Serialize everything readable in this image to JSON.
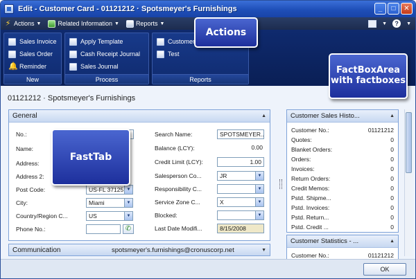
{
  "window": {
    "title": "Edit - Customer Card - 01121212 · Spotsmeyer's Furnishings"
  },
  "menubar": {
    "items": [
      {
        "label": "Actions",
        "icon": "lightning-icon"
      },
      {
        "label": "Related Information",
        "icon": "related-info-icon"
      },
      {
        "label": "Reports",
        "icon": "reports-icon"
      }
    ],
    "help_label": "?"
  },
  "ribbon": {
    "groups": [
      {
        "label": "New",
        "items": [
          "Sales Invoice",
          "Sales Order",
          "Reminder"
        ]
      },
      {
        "label": "Process",
        "items": [
          "Apply Template",
          "Cash Receipt Journal",
          "Sales Journal"
        ]
      },
      {
        "label": "Reports",
        "items": [
          "Customer",
          "Test"
        ]
      }
    ]
  },
  "page": {
    "title": "01121212 · Spotsmeyer's Furnishings"
  },
  "general": {
    "header": "General",
    "left_fields": [
      {
        "label": "No.:",
        "value": ""
      },
      {
        "label": "Name:",
        "value": ""
      },
      {
        "label": "Address:",
        "value": ""
      },
      {
        "label": "Address 2:",
        "value": ""
      },
      {
        "label": "Post Code:",
        "value": "US-FL 37125"
      },
      {
        "label": "City:",
        "value": "Miami"
      },
      {
        "label": "Country/Region C...",
        "value": "US"
      },
      {
        "label": "Phone No.:",
        "value": ""
      }
    ],
    "right_fields": [
      {
        "label": "Search Name:",
        "value": "SPOTSMEYER..."
      },
      {
        "label": "Balance (LCY):",
        "value": "0.00"
      },
      {
        "label": "Credit Limit (LCY):",
        "value": "1.00"
      },
      {
        "label": "Salesperson Co...",
        "value": "JR"
      },
      {
        "label": "Responsibility C...",
        "value": ""
      },
      {
        "label": "Service Zone C...",
        "value": "X"
      },
      {
        "label": "Blocked:",
        "value": ""
      },
      {
        "label": "Last Date Modifi...",
        "value": "8/15/2008"
      }
    ]
  },
  "communication": {
    "header": "Communication",
    "email": "spotsmeyer's.furnishings@cronuscorp.net"
  },
  "factbox_sales": {
    "header": "Customer Sales Histo...",
    "rows": [
      {
        "label": "Customer No.:",
        "value": "01121212"
      },
      {
        "label": "Quotes:",
        "value": "0"
      },
      {
        "label": "Blanket Orders:",
        "value": "0"
      },
      {
        "label": "Orders:",
        "value": "0"
      },
      {
        "label": "Invoices:",
        "value": "0"
      },
      {
        "label": "Return Orders:",
        "value": "0"
      },
      {
        "label": "Credit Memos:",
        "value": "0"
      },
      {
        "label": "Pstd. Shipme...",
        "value": "0"
      },
      {
        "label": "Pstd. Invoices:",
        "value": "0"
      },
      {
        "label": "Pstd. Return...",
        "value": "0"
      },
      {
        "label": "Pstd. Credit ...",
        "value": "0"
      }
    ]
  },
  "factbox_stats": {
    "header": "Customer Statistics - ...",
    "rows": [
      {
        "label": "Customer No.:",
        "value": "01121212"
      }
    ]
  },
  "footer": {
    "ok_label": "OK"
  },
  "callouts": {
    "actions": "Actions",
    "factbox_area": "FactBoxArea with factboxes",
    "fasttab": "FastTab"
  }
}
